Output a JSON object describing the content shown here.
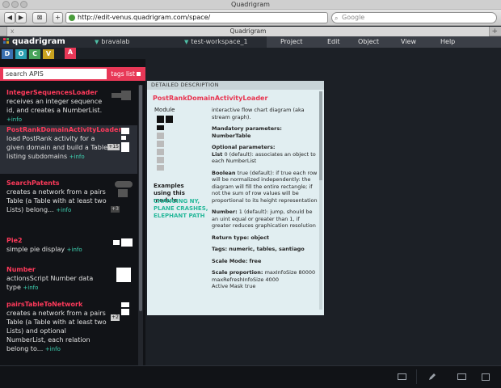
{
  "browser": {
    "window_title": "Quadrigram",
    "url": "http://edit-venus.quadrigram.com/space/",
    "search_placeholder": "Google",
    "tab_title": "Quadrigram",
    "back_label": "◀",
    "forward_label": "▶",
    "reader_label": "⊠",
    "add_label": "+",
    "tab_close": "x",
    "new_tab": "+"
  },
  "app": {
    "logo": "quadrigram",
    "lab": "bravalab",
    "workspace": "test-workspace_1",
    "menu": [
      "Project",
      "Edit",
      "Object",
      "View",
      "Help"
    ],
    "categories": [
      {
        "label": "D",
        "color": "#3a6fb0"
      },
      {
        "label": "O",
        "color": "#2a9fb0"
      },
      {
        "label": "C",
        "color": "#48a35a"
      },
      {
        "label": "V",
        "color": "#c9a21f"
      },
      {
        "label": "A",
        "color": "#e83857"
      }
    ]
  },
  "search": {
    "value": "search APIS",
    "tags_label": "tags list"
  },
  "modules": [
    {
      "title": "IntegerSequencesLoader",
      "desc": "receives an integer sequence id, and creates a NumberList.",
      "info": "+info",
      "badge": ""
    },
    {
      "title": "PostRankDomainActivityLoader",
      "desc": "load PostRank activity for a given domain and build a Table listing subdomains",
      "info": "+info",
      "badge": "+15"
    },
    {
      "title": "SearchPatents",
      "desc": "creates a network from a pairs Table (a Table with at least two Lists) belong...",
      "info": "+info",
      "badge": "+3"
    },
    {
      "title": "Pie2",
      "desc": "simple pie display",
      "info": "+info",
      "badge": ""
    },
    {
      "title": "Number",
      "desc": "actionsScript Number data type",
      "info": "+info",
      "badge": ""
    },
    {
      "title": "pairsTableToNetwork",
      "desc": "creates a network from a pairs Table (a Table with at least two Lists) and optional NumberList, each relation belong to...",
      "info": "+info",
      "badge": "+2"
    }
  ],
  "detail": {
    "header": "DETAILED DESCRIPTION",
    "title": "PostRankDomainActivityLoader",
    "module_label": "Module",
    "examples_label": "Examples using this module",
    "examples": "CHANGING NY, PLANE CRASHES, ELEPHANT PATH",
    "intro": "interactive flow chart diagram (aka stream graph).",
    "mandatory_label": "Mandatory parameters:",
    "mandatory_value": "NumberTable",
    "optional_label": "Optional parameters:",
    "list_param_name": "List",
    "list_param_text": "0 (default): associates an object to each NumberList",
    "boolean_name": "Boolean",
    "boolean_text": "true (default): if true each row will be normalized independently: the diagram will fill the entire rectangle; if not the sum of row values will be proportional to its height representation",
    "number_name": "Number:",
    "number_text": "1 (default): jump, should be an uint equal or greater than 1, if greater reduces graphication resolution",
    "return_label": "Return type:",
    "return_value": "object",
    "tags_label": "Tags:",
    "tags_value": "numeric, tables, santiago",
    "scale_label": "Scale Mode:",
    "scale_value": "free",
    "scale_prop_label": "Scale proportion:",
    "scale_prop_value": "maxInfoSize 80000",
    "refresh_value": "maxRefreshInfoSize 4000",
    "active_mask": "Active Mask true"
  }
}
